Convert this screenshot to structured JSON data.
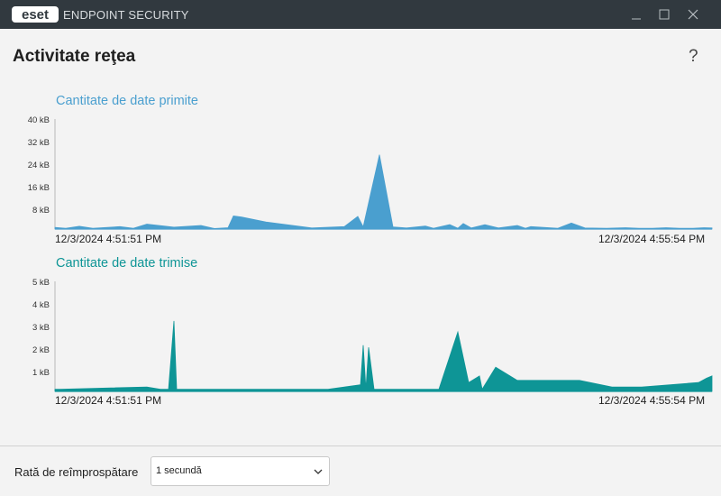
{
  "window": {
    "logo_text": "eset",
    "app_title": "ENDPOINT SECURITY"
  },
  "page": {
    "title": "Activitate reţea",
    "help": "?"
  },
  "charts": [
    {
      "title": "Cantitate de date primite",
      "color": "#4a9fcf",
      "y_ticks": [
        "40 kB",
        "32 kB",
        "24 kB",
        "16 kB",
        "8 kB"
      ],
      "start_time": "12/3/2024 4:51:51 PM",
      "end_time": "12/3/2024 4:55:54 PM"
    },
    {
      "title": "Cantitate de date trimise",
      "color": "#0e9596",
      "y_ticks": [
        "5 kB",
        "4 kB",
        "3 kB",
        "2 kB",
        "1 kB"
      ],
      "start_time": "12/3/2024 4:51:51 PM",
      "end_time": "12/3/2024 4:55:54 PM"
    }
  ],
  "chart_data": [
    {
      "type": "area",
      "title": "Cantitate de date primite",
      "ylabel": "",
      "ylim": [
        0,
        40
      ],
      "y_unit": "kB",
      "x_range": [
        "12/3/2024 4:51:51 PM",
        "12/3/2024 4:55:54 PM"
      ],
      "x": [
        0,
        4,
        9,
        14,
        24,
        29,
        34,
        44,
        54,
        58,
        59,
        64,
        66,
        69,
        78,
        95,
        107,
        112,
        114,
        120,
        125,
        130,
        137,
        140,
        146,
        149,
        151,
        154,
        159,
        164,
        171,
        174,
        176,
        186,
        191,
        196,
        204,
        211,
        216,
        221,
        226,
        231,
        236,
        240,
        243
      ],
      "y": [
        0.6,
        0.3,
        1.0,
        0.3,
        0.9,
        0.3,
        1.8,
        0.7,
        1.3,
        0.4,
        0.2,
        0.5,
        4.8,
        4.4,
        2.6,
        0.4,
        0.9,
        4.6,
        0.8,
        27.0,
        0.8,
        0.4,
        1.1,
        0.3,
        1.6,
        0.3,
        2.0,
        0.4,
        1.6,
        0.4,
        1.3,
        0.3,
        0.9,
        0.3,
        2.2,
        0.4,
        0.3,
        0.5,
        0.3,
        0.3,
        0.5,
        0.3,
        0.3,
        0.5,
        0.4
      ]
    },
    {
      "type": "area",
      "title": "Cantitate de date trimise",
      "ylabel": "",
      "ylim": [
        0,
        5
      ],
      "y_unit": "kB",
      "x_range": [
        "12/3/2024 4:51:51 PM",
        "12/3/2024 4:55:54 PM"
      ],
      "x": [
        0,
        2,
        34,
        39,
        42,
        44,
        45,
        61,
        62,
        65,
        67,
        82,
        101,
        113,
        114,
        115,
        116,
        118,
        122,
        142,
        149,
        153,
        157,
        158,
        163,
        171,
        194,
        206,
        217,
        238,
        241,
        243
      ],
      "y": [
        0.1,
        0.1,
        0.2,
        0.1,
        0.1,
        3.2,
        0.1,
        0.1,
        0.1,
        0.1,
        0.1,
        0.1,
        0.1,
        0.3,
        2.1,
        0.1,
        2.0,
        0.1,
        0.1,
        0.1,
        2.7,
        0.4,
        0.7,
        0.1,
        1.1,
        0.5,
        0.5,
        0.2,
        0.2,
        0.4,
        0.6,
        0.7
      ]
    }
  ],
  "footer": {
    "rate_label": "Rată de reîmprospătare",
    "rate_value": "1 secundă"
  },
  "colors": {
    "titlebar": "#31393f",
    "received": "#4a9fcf",
    "sent": "#0e9596",
    "brand": "#ffffff"
  }
}
